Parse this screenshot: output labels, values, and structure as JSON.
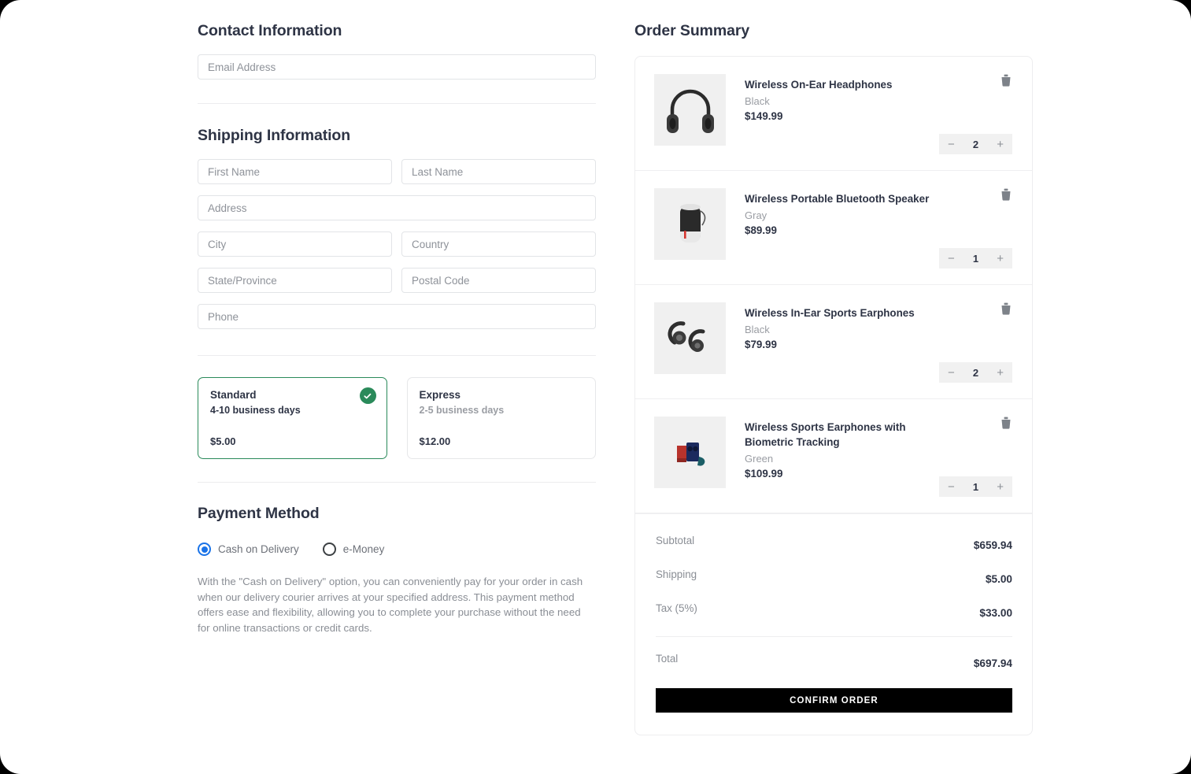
{
  "contact": {
    "title": "Contact Information",
    "email_placeholder": "Email Address",
    "email_value": ""
  },
  "shipping": {
    "title": "Shipping Information",
    "fields": [
      {
        "name": "first-name",
        "placeholder": "First Name",
        "value": ""
      },
      {
        "name": "last-name",
        "placeholder": "Last Name",
        "value": ""
      },
      {
        "name": "address",
        "placeholder": "Address",
        "value": ""
      },
      {
        "name": "city",
        "placeholder": "City",
        "value": ""
      },
      {
        "name": "country",
        "placeholder": "Country",
        "value": ""
      },
      {
        "name": "state",
        "placeholder": "State/Province",
        "value": ""
      },
      {
        "name": "postal",
        "placeholder": "Postal Code",
        "value": ""
      },
      {
        "name": "phone",
        "placeholder": "Phone",
        "value": ""
      }
    ],
    "options": [
      {
        "name": "Standard",
        "days": "4-10 business days",
        "price": "$5.00",
        "selected": true
      },
      {
        "name": "Express",
        "days": "2-5 business days",
        "price": "$12.00",
        "selected": false
      }
    ]
  },
  "payment": {
    "title": "Payment Method",
    "options": [
      {
        "label": "Cash on Delivery",
        "selected": true
      },
      {
        "label": "e-Money",
        "selected": false
      }
    ],
    "description": "With the \"Cash on Delivery\" option, you can conveniently pay for your order in cash when our delivery courier arrives at your specified address. This payment method offers ease and flexibility, allowing you to complete your purchase without the need for online transactions or credit cards."
  },
  "order_summary": {
    "title": "Order Summary",
    "items": [
      {
        "name": "Wireless On-Ear Headphones",
        "variant": "Black",
        "price": "$149.99",
        "quantity": "2",
        "icon": "headphones-product-image"
      },
      {
        "name": "Wireless Portable Bluetooth Speaker",
        "variant": "Gray",
        "price": "$89.99",
        "quantity": "1",
        "icon": "speaker-product-image"
      },
      {
        "name": "Wireless In-Ear Sports Earphones",
        "variant": "Black",
        "price": "$79.99",
        "quantity": "2",
        "icon": "earphones-product-image"
      },
      {
        "name": "Wireless Sports Earphones with Biometric Tracking",
        "variant": "Green",
        "price": "$109.99",
        "quantity": "1",
        "icon": "biometric-earbuds-product-image"
      }
    ],
    "totals": [
      {
        "label": "Subtotal",
        "value": "$659.94"
      },
      {
        "label": "Shipping",
        "value": "$5.00"
      },
      {
        "label": "Tax (5%)",
        "value": "$33.00"
      },
      {
        "label": "Total",
        "value": "$697.94"
      }
    ],
    "confirm_label": "CONFIRM ORDER",
    "decrease_label": "−",
    "increase_label": "+"
  },
  "colors": {
    "heading": "#2e3445",
    "accent_green": "#2a8a5a",
    "accent_blue": "#1a73e8",
    "confirm_bg": "#000000"
  }
}
